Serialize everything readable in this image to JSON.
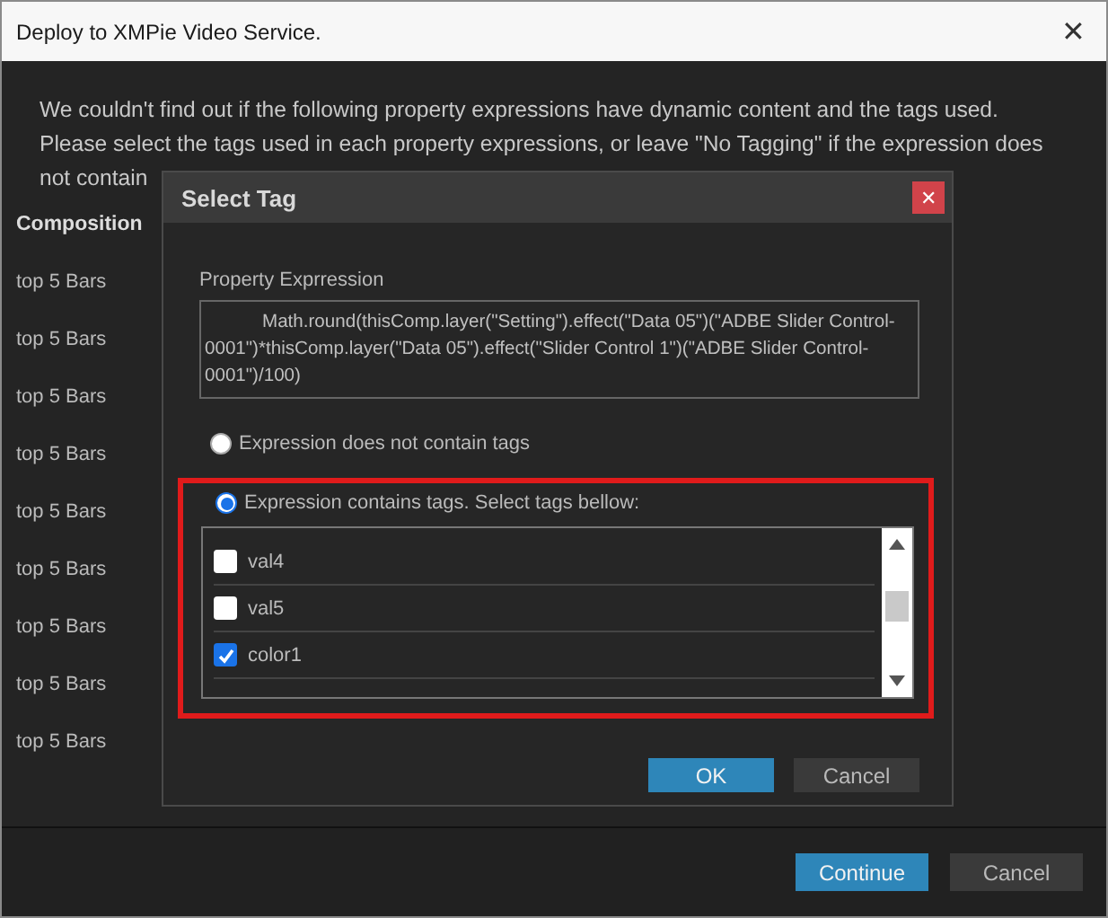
{
  "window": {
    "title": "Deploy to XMPie Video Service.",
    "close": "✕"
  },
  "message": [
    "We couldn't find out if the following property expressions have dynamic content and the tags used.",
    "Please select the tags used in each property expressions, or leave \"No Tagging\" if the expression does",
    "not contain"
  ],
  "table": {
    "columns": [
      "Composition"
    ],
    "rows": [
      "top 5 Bars",
      "top 5 Bars",
      "top 5 Bars",
      "top 5 Bars",
      "top 5 Bars",
      "top 5 Bars",
      "top 5 Bars",
      "top 5 Bars",
      "top 5 Bars"
    ]
  },
  "footer_buttons": [
    {
      "label": "Continue",
      "kind": "primary"
    },
    {
      "label": "Cancel",
      "kind": "secondary"
    }
  ],
  "dialog": {
    "title": "Select Tag",
    "close": "✕",
    "expression_label": "Property Exprression",
    "expression": "Math.round(thisComp.layer(\"Setting\").effect(\"Data 05\")(\"ADBE Slider Control-0001\")*thisComp.layer(\"Data 05\").effect(\"Slider Control 1\")(\"ADBE Slider Control-0001\")/100)",
    "options": [
      {
        "label": "Expression does not contain tags",
        "selected": false
      },
      {
        "label": "Expression contains tags. Select tags bellow:",
        "selected": true
      }
    ],
    "tags": [
      {
        "label": "val4",
        "checked": false
      },
      {
        "label": "val5",
        "checked": false
      },
      {
        "label": "color1",
        "checked": true
      }
    ],
    "buttons": [
      {
        "label": "OK",
        "kind": "primary"
      },
      {
        "label": "Cancel",
        "kind": "secondary"
      }
    ]
  }
}
